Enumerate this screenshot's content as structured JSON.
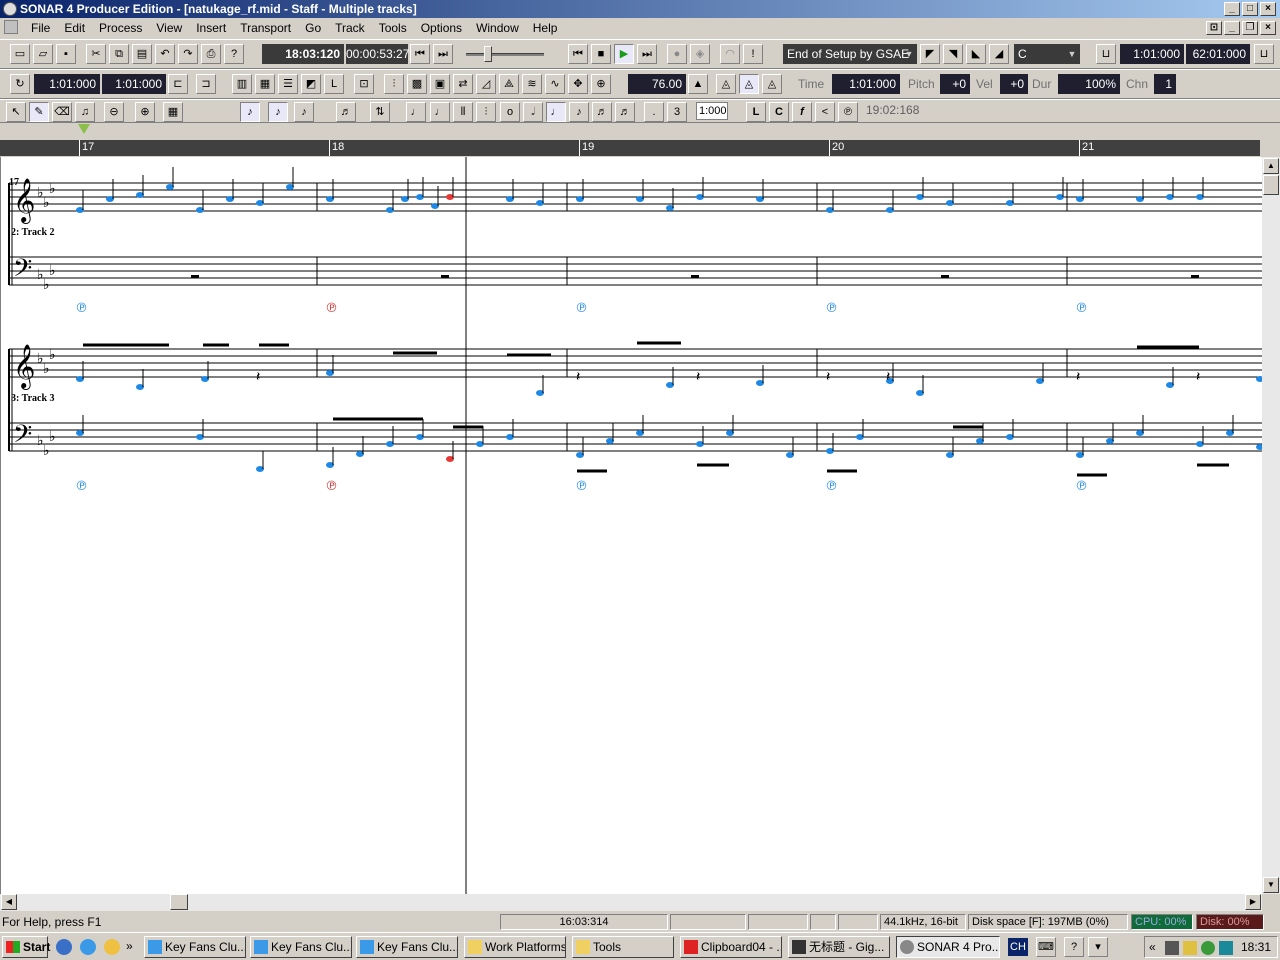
{
  "window": {
    "title": "SONAR 4 Producer Edition - [natukage_rf.mid - Staff - Multiple tracks]"
  },
  "menu": [
    "File",
    "Edit",
    "Process",
    "View",
    "Insert",
    "Transport",
    "Go",
    "Track",
    "Tools",
    "Options",
    "Window",
    "Help"
  ],
  "transport": {
    "now_time": "18:03:120",
    "smpte": "00:00:53:27",
    "marker_combo": "End of Setup by GSAE",
    "key_combo": "C",
    "loop_start": "1:01:000",
    "loop_end": "62:01:000"
  },
  "toolbar2": {
    "from": "1:01:000",
    "thru": "1:01:000",
    "tempo": "76.00",
    "time_label": "Time",
    "time_value": "1:01:000",
    "pitch_label": "Pitch",
    "pitch_value": "+0",
    "vel_label": "Vel",
    "vel_value": "+0",
    "dur_label": "Dur",
    "dur_value": "100%",
    "chn_label": "Chn",
    "chn_value": "1"
  },
  "toolbar3": {
    "snap_value": "1:000",
    "cursor_time": "19:02:168",
    "letter_buttons": [
      "L",
      "C",
      "f",
      "<"
    ]
  },
  "ruler": {
    "measures": [
      "17",
      "18",
      "19",
      "20",
      "21"
    ]
  },
  "staff": {
    "measure_number": "17",
    "track_labels": [
      "2: Track 2",
      "3: Track 3"
    ]
  },
  "statusbar": {
    "help": "For Help, press F1",
    "time": "16:03:314",
    "format": "44.1kHz, 16-bit",
    "disk_space": "Disk space [F]: 197MB (0%)",
    "cpu": "CPU: 00%",
    "disk": "Disk: 00%"
  },
  "taskbar": {
    "start": "Start",
    "tasks": [
      "Key Fans Clu...",
      "Key Fans Clu...",
      "Key Fans Clu...",
      "Work Platforms",
      "Tools",
      "Clipboard04 - ...",
      "无标题 - Gig...",
      "SONAR 4 Pro..."
    ],
    "lang": "CH",
    "clock": "18:31"
  },
  "colors": {
    "note": "#1e88e5",
    "selected_note": "#e53935",
    "title_start": "#0a246a",
    "title_end": "#a6caf0"
  }
}
